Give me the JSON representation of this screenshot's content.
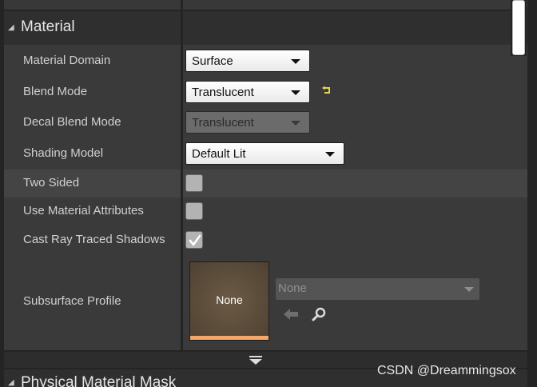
{
  "category": {
    "title": "Material"
  },
  "next_category": {
    "title": "Physical Material Mask"
  },
  "properties": {
    "material_domain": {
      "label": "Material Domain",
      "value": "Surface"
    },
    "blend_mode": {
      "label": "Blend Mode",
      "value": "Translucent"
    },
    "decal_blend_mode": {
      "label": "Decal Blend Mode",
      "value": "Translucent"
    },
    "shading_model": {
      "label": "Shading Model",
      "value": "Default Lit"
    },
    "two_sided": {
      "label": "Two Sided",
      "checked": false
    },
    "use_material_attributes": {
      "label": "Use Material Attributes",
      "checked": false
    },
    "cast_ray_traced_shadows": {
      "label": "Cast Ray Traced Shadows",
      "checked": true
    },
    "subsurface_profile": {
      "label": "Subsurface Profile",
      "thumbnail_text": "None",
      "asset_value": "None"
    }
  },
  "icons": {
    "reset": "reset-to-default-icon",
    "back": "arrow-left-icon",
    "browse": "magnifier-icon",
    "expand": "expand-advanced-icon",
    "collapse": "category-collapse-triangle-icon"
  },
  "colors": {
    "thumbnail_bar": "#f4a76a",
    "reset_icon": "#e8d44d"
  },
  "watermark": "CSDN @Dreammingsox"
}
